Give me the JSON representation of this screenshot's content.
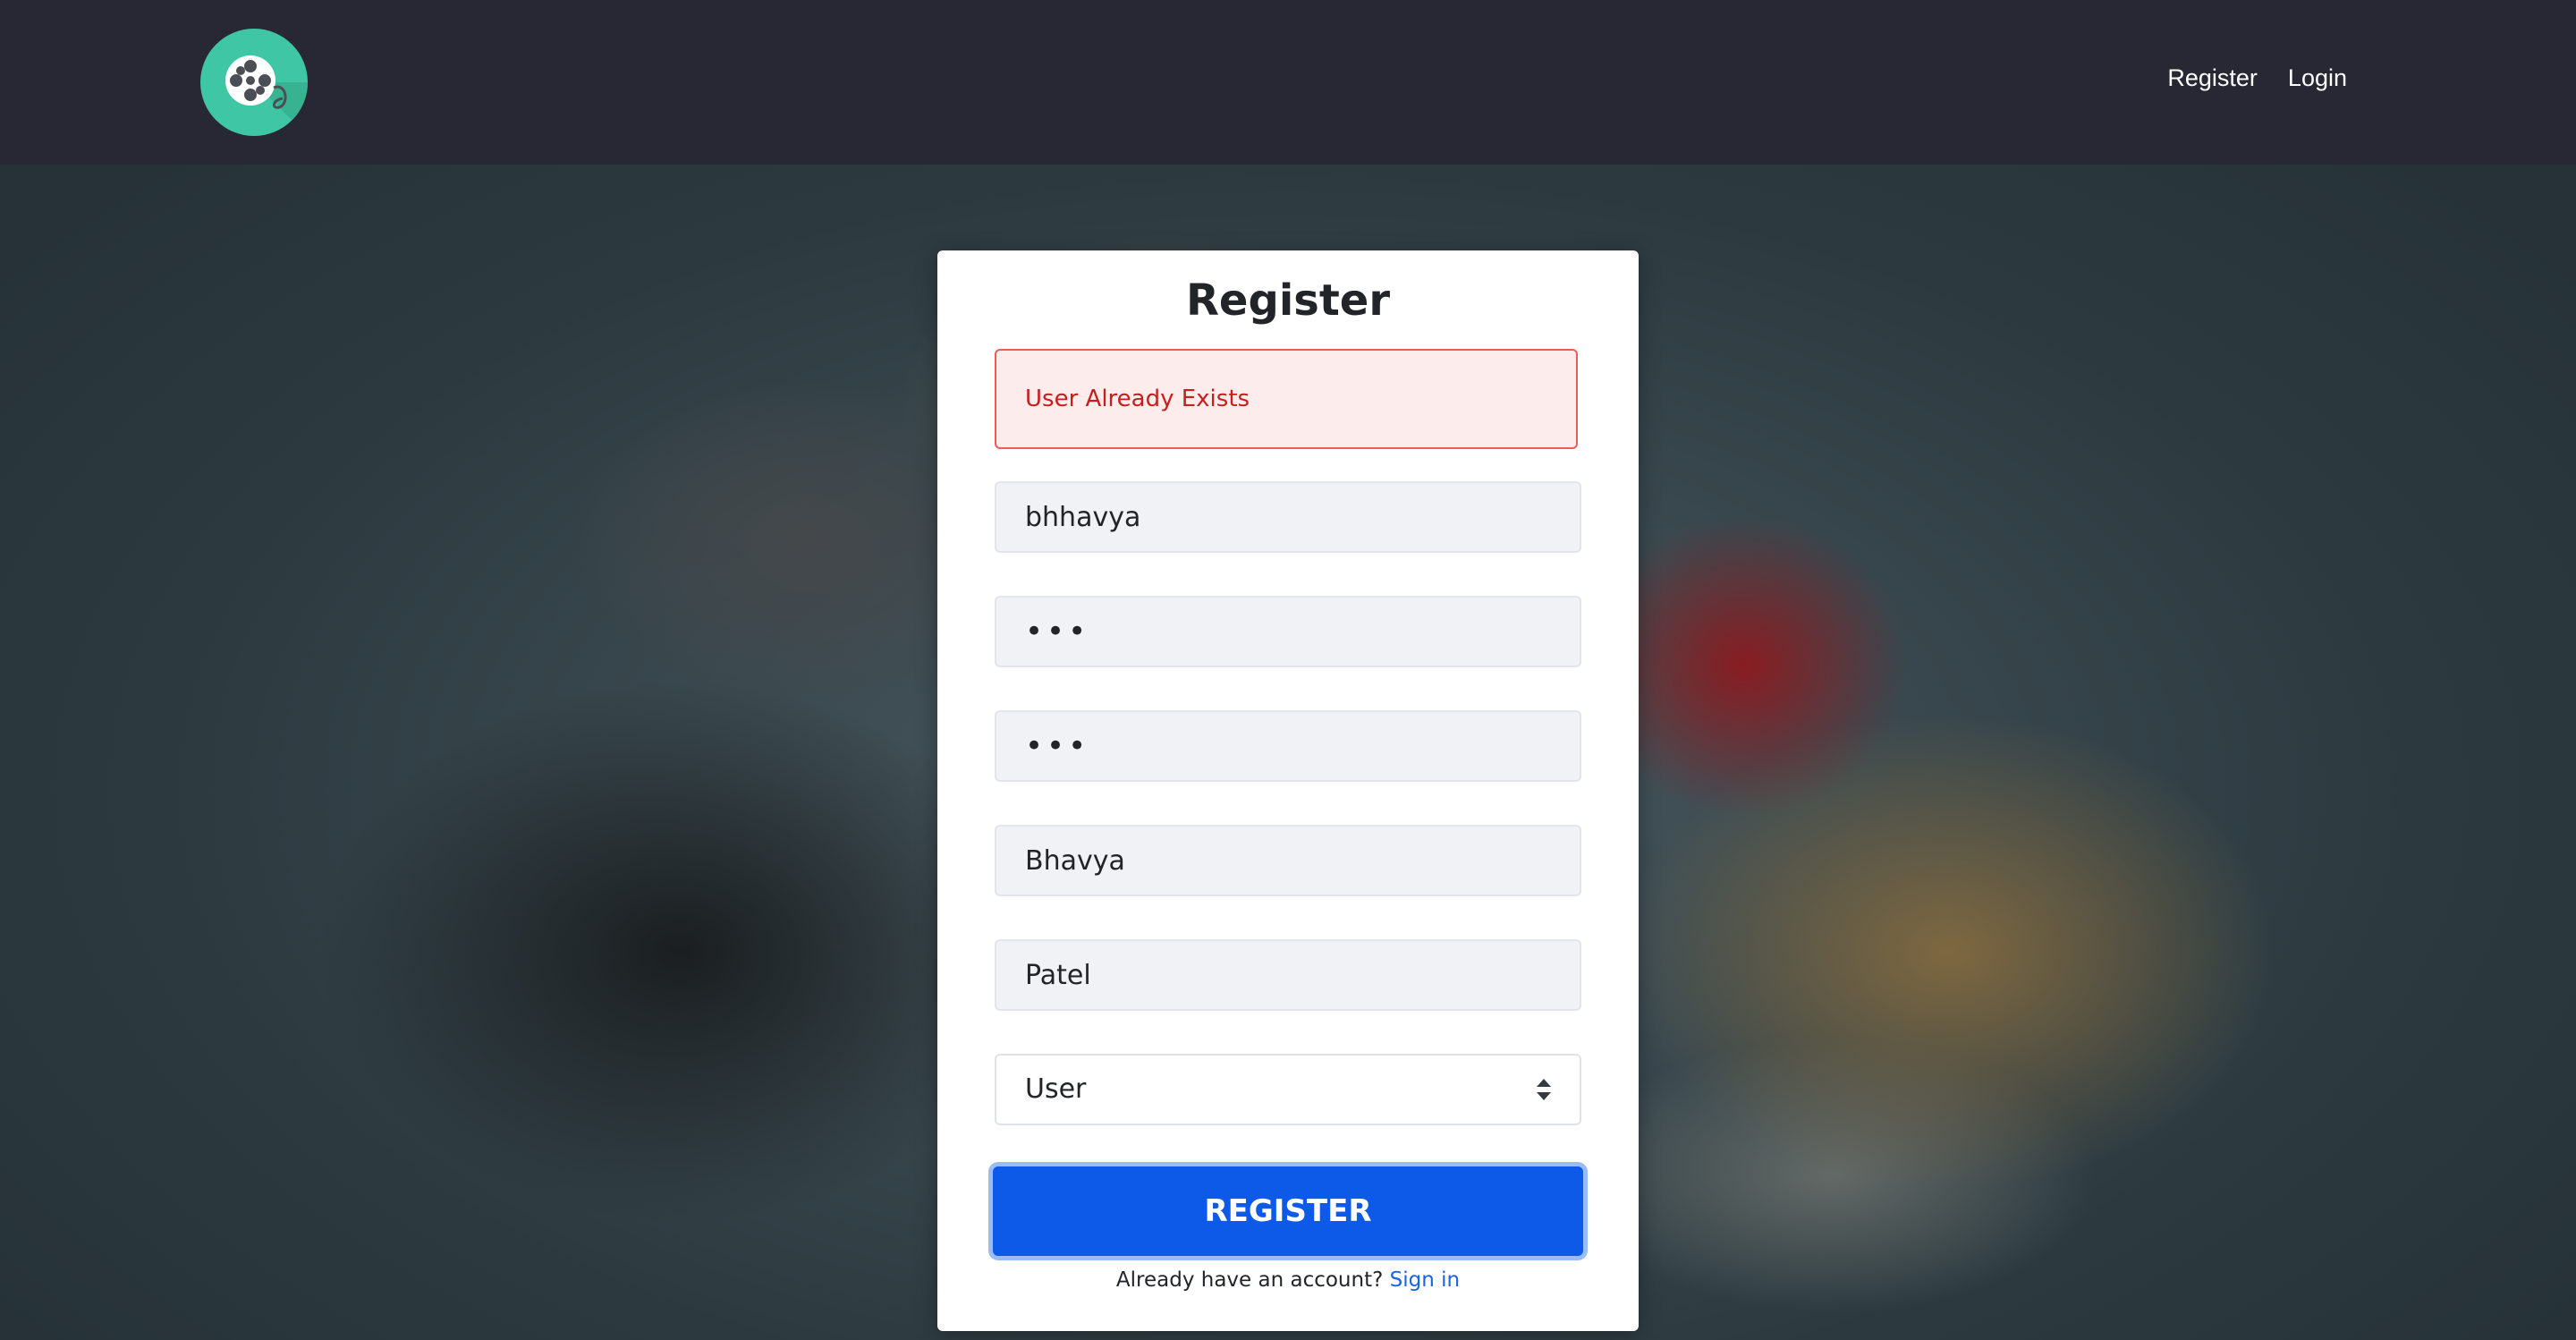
{
  "nav": {
    "logo_icon": "film-reel-icon",
    "links": [
      "Register",
      "Login"
    ]
  },
  "form": {
    "title": "Register",
    "alert": "User Already Exists",
    "username": "bhhavya",
    "password": "•••",
    "confirm_password": "•••",
    "first_name": "Bhavya",
    "last_name": "Patel",
    "role_selected": "User",
    "submit_label": "REGISTER",
    "footer_text": "Already have an account?",
    "signin_label": "Sign in"
  },
  "colors": {
    "navbar": "#272834",
    "logo": "#3fc6a4",
    "primary": "#0d5ae8",
    "alert_text": "#c81e1e",
    "alert_bg": "#fdecec"
  }
}
